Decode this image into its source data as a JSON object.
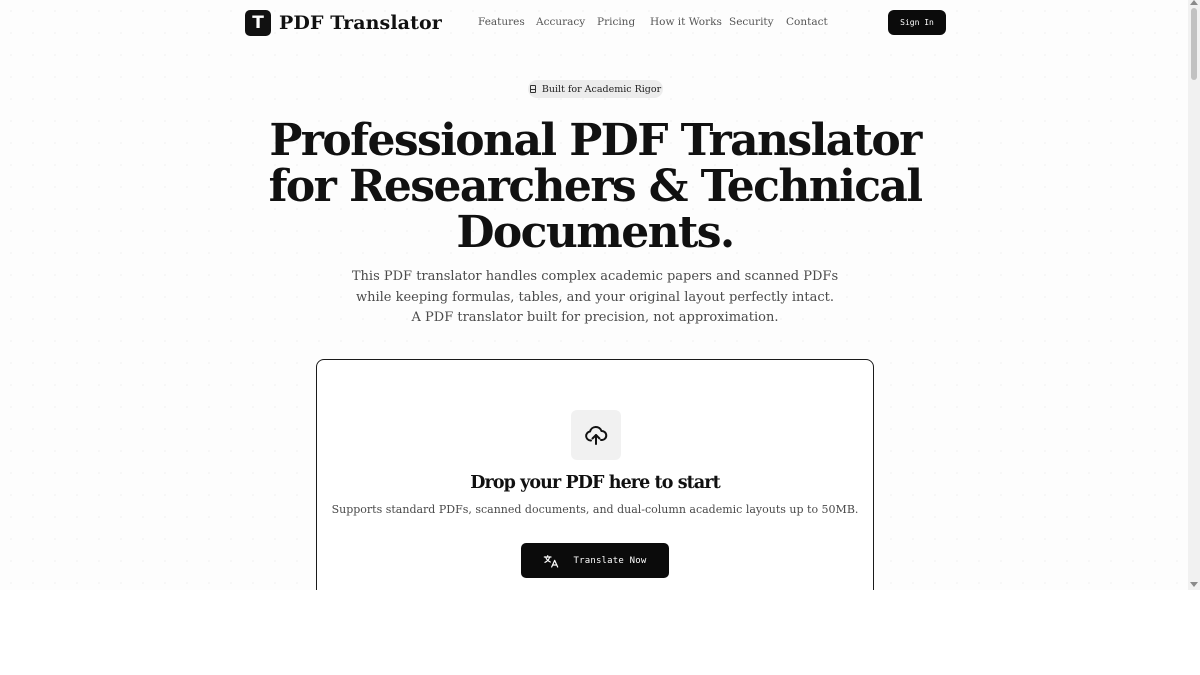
{
  "brand": {
    "logo_letter": "T",
    "name": "PDF Translator"
  },
  "nav": {
    "items": [
      "Features",
      "Accuracy",
      "Pricing",
      "How it Works",
      "Security",
      "Contact"
    ],
    "sign_in": "Sign In"
  },
  "hero": {
    "badge": "Built for Academic Rigor",
    "headline": "Professional PDF Translator for Researchers & Technical Documents.",
    "subtitle": "This PDF translator handles complex academic papers and scanned PDFs while keeping formulas, tables, and your original layout perfectly intact. A PDF translator built for precision, not approximation."
  },
  "upload": {
    "icon": "cloud-upload-icon",
    "title": "Drop your PDF here to start",
    "description": "Supports standard PDFs, scanned documents, and dual-column academic layouts up to 50MB.",
    "button_label": "Translate Now",
    "button_icon": "translate-icon"
  },
  "colors": {
    "accent": "#0b0b0b",
    "text": "#111111",
    "muted": "#4a4a4a",
    "badge_bg": "#ececec"
  }
}
